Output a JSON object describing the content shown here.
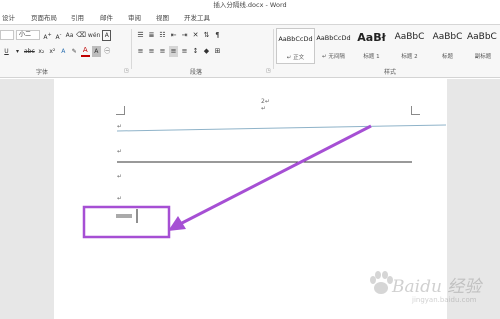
{
  "window": {
    "title": "插入分隔线.docx - Word"
  },
  "tabs": [
    "设计",
    "页面布局",
    "引用",
    "邮件",
    "审阅",
    "视图",
    "开发工具"
  ],
  "font": {
    "name_partial": "",
    "size": "小二"
  },
  "ribbon": {
    "group_font": "字体",
    "group_paragraph": "段落",
    "group_styles": "样式"
  },
  "styles": [
    {
      "sample": "AaBbCcDd",
      "name": "↵ 正文",
      "selected": true
    },
    {
      "sample": "AaBbCcDd",
      "name": "↵ 无间隔",
      "selected": false
    },
    {
      "sample": "AaBł",
      "name": "标题 1",
      "selected": false
    },
    {
      "sample": "AaBbC",
      "name": "标题 2",
      "selected": false
    },
    {
      "sample": "AaBbC",
      "name": "标题",
      "selected": false
    },
    {
      "sample": "AaBbC",
      "name": "副标题",
      "selected": false
    }
  ],
  "document": {
    "page_number_mark": "2↵",
    "paragraph_mark": "↵",
    "separator_colors": {
      "top": "#8fb3c9",
      "middle": "#333333"
    }
  },
  "annotation": {
    "color": "#a64fd4"
  },
  "watermark": {
    "text": "Baidu 经验",
    "sub": "jingyan.baidu.com"
  }
}
